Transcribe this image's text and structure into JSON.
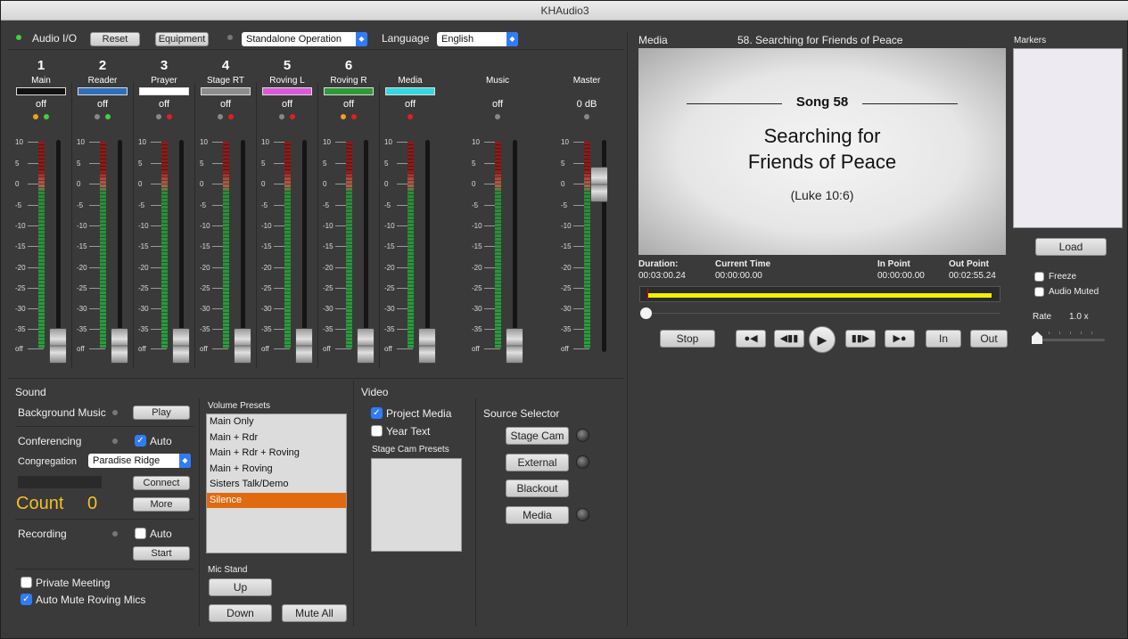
{
  "window": {
    "title": "KHAudio3"
  },
  "toolbar": {
    "audio_io_label": "Audio I/O",
    "reset_label": "Reset",
    "equipment_label": "Equipment",
    "mode_value": "Standalone Operation",
    "language_label": "Language",
    "language_value": "English"
  },
  "mixer": {
    "channels": [
      {
        "num": "1",
        "name": "Main",
        "status": "off",
        "color": "#111111"
      },
      {
        "num": "2",
        "name": "Reader",
        "status": "off",
        "color": "#2e6fba"
      },
      {
        "num": "3",
        "name": "Prayer",
        "status": "off",
        "color": "#ffffff"
      },
      {
        "num": "4",
        "name": "Stage RT",
        "status": "off",
        "color": "#8c8c8c"
      },
      {
        "num": "5",
        "name": "Roving L",
        "status": "off",
        "color": "#d85ad8"
      },
      {
        "num": "6",
        "name": "Roving R",
        "status": "off",
        "color": "#2f9a3a"
      },
      {
        "num": "",
        "name": "Media",
        "status": "off",
        "color": "#35d7e0"
      },
      {
        "num": "",
        "name": "Music",
        "status": "off",
        "color": ""
      },
      {
        "num": "",
        "name": "Master",
        "status": "0 dB",
        "color": ""
      }
    ],
    "scale": [
      "10",
      "5",
      "0",
      "-5",
      "-10",
      "-15",
      "-20",
      "-25",
      "-30",
      "-35",
      "off"
    ]
  },
  "sound": {
    "title": "Sound",
    "background_music_label": "Background Music",
    "play_label": "Play",
    "conferencing_label": "Conferencing",
    "auto_label": "Auto",
    "congregation_label": "Congregation",
    "congregation_value": "Paradise Ridge",
    "connect_label": "Connect",
    "count_label": "Count",
    "count_value": "0",
    "more_label": "More",
    "recording_label": "Recording",
    "recording_auto_label": "Auto",
    "start_label": "Start",
    "private_meeting_label": "Private Meeting",
    "auto_mute_label": "Auto Mute Roving Mics"
  },
  "presets": {
    "title": "Volume Presets",
    "items": [
      "Main Only",
      "Main + Rdr",
      "Main + Rdr + Roving",
      "Main + Roving",
      "Sisters Talk/Demo",
      "Silence"
    ],
    "selected": "Silence",
    "mic_stand_label": "Mic Stand",
    "up_label": "Up",
    "down_label": "Down",
    "mute_all_label": "Mute All"
  },
  "video": {
    "title": "Video",
    "project_media_label": "Project Media",
    "year_text_label": "Year Text",
    "stage_cam_presets_label": "Stage Cam Presets",
    "source_selector_label": "Source Selector",
    "stage_cam_label": "Stage Cam",
    "external_label": "External",
    "blackout_label": "Blackout",
    "media_label": "Media"
  },
  "media": {
    "title": "Media",
    "current_title": "58. Searching for Friends of Peace",
    "slide": {
      "song": "Song 58",
      "line1": "Searching for",
      "line2": "Friends of Peace",
      "ref": "(Luke 10:6)"
    },
    "duration_label": "Duration:",
    "duration_value": "00:03:00.24",
    "current_time_label": "Current Time",
    "current_time_value": "00:00:00.00",
    "in_point_label": "In Point",
    "in_point_value": "00:00:00.00",
    "out_point_label": "Out Point",
    "out_point_value": "00:02:55.24",
    "stop_label": "Stop",
    "in_label": "In",
    "out_label": "Out"
  },
  "markers": {
    "title": "Markers",
    "load_label": "Load",
    "freeze_label": "Freeze",
    "audio_muted_label": "Audio Muted",
    "rate_label": "Rate",
    "rate_value": "1.0 x"
  },
  "colors": {
    "accent": "#2f7cf6",
    "count": "#f2c02a",
    "progress": "#f0f000",
    "selected": "#e06a10"
  }
}
